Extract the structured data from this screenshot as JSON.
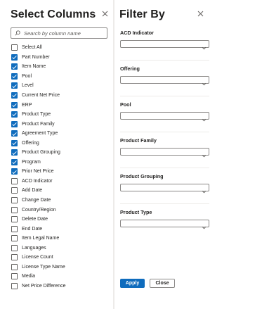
{
  "select_columns": {
    "title": "Select Columns",
    "close_icon": "close-icon",
    "search": {
      "placeholder": "Search by column name",
      "value": "",
      "icon": "search-icon"
    },
    "items": [
      {
        "label": "Select All",
        "checked": false
      },
      {
        "label": "Part Number",
        "checked": true
      },
      {
        "label": "Item Name",
        "checked": true
      },
      {
        "label": "Pool",
        "checked": true
      },
      {
        "label": "Level",
        "checked": true
      },
      {
        "label": "Current Net Price",
        "checked": true
      },
      {
        "label": "ERP",
        "checked": true
      },
      {
        "label": "Product Type",
        "checked": true
      },
      {
        "label": "Product Family",
        "checked": true
      },
      {
        "label": "Agreement Type",
        "checked": true
      },
      {
        "label": "Offering",
        "checked": true
      },
      {
        "label": "Product Grouping",
        "checked": true
      },
      {
        "label": "Program",
        "checked": true
      },
      {
        "label": "Prior Net Price",
        "checked": true
      },
      {
        "label": "ACD Indicator",
        "checked": false
      },
      {
        "label": "Add Date",
        "checked": false
      },
      {
        "label": "Change Date",
        "checked": false
      },
      {
        "label": "Country/Region",
        "checked": false
      },
      {
        "label": "Delete Date",
        "checked": false
      },
      {
        "label": "End Date",
        "checked": false
      },
      {
        "label": "Item Legal Name",
        "checked": false
      },
      {
        "label": "Languages",
        "checked": false
      },
      {
        "label": "License Count",
        "checked": false
      },
      {
        "label": "License Type Name",
        "checked": false
      },
      {
        "label": "Media",
        "checked": false
      },
      {
        "label": "Net Price Difference",
        "checked": false
      }
    ]
  },
  "filter_by": {
    "title": "Filter By",
    "close_icon": "close-icon",
    "filters": [
      {
        "label": "ACD Indicator",
        "value": ""
      },
      {
        "label": "Offering",
        "value": ""
      },
      {
        "label": "Pool",
        "value": ""
      },
      {
        "label": "Product Family",
        "value": ""
      },
      {
        "label": "Product Grouping",
        "value": ""
      },
      {
        "label": "Product Type",
        "value": ""
      }
    ],
    "apply_label": "Apply",
    "close_label": "Close"
  },
  "colors": {
    "accent": "#0f6cbd",
    "border": "#8a8886",
    "divider": "#edebe9",
    "text": "#201f1e"
  }
}
